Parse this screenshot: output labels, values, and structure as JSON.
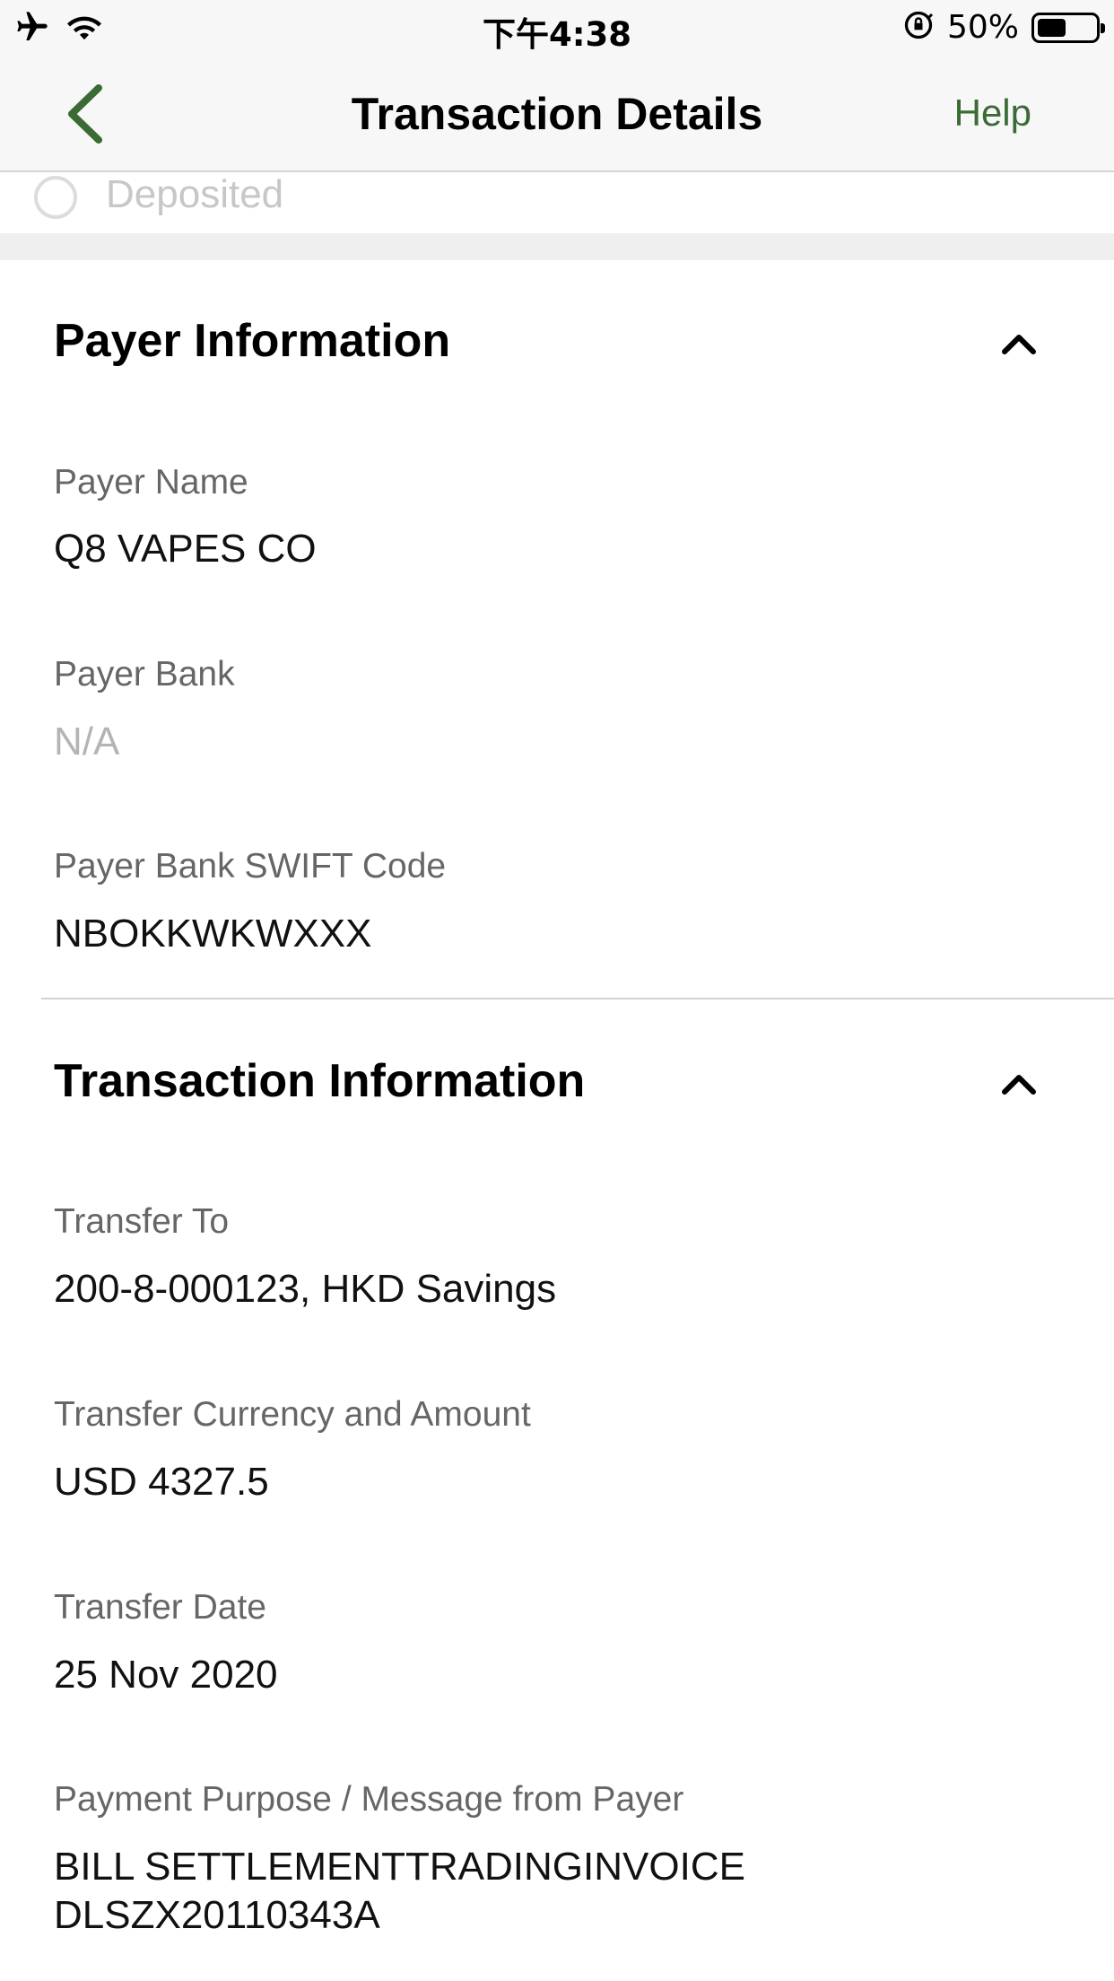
{
  "status_bar": {
    "time": "下午4:38",
    "battery_percent": "50%",
    "battery_level": 0.5,
    "icons": [
      "airplane-icon",
      "wifi-icon",
      "orientation-lock-icon",
      "battery-icon"
    ]
  },
  "nav": {
    "title": "Transaction Details",
    "help_label": "Help",
    "accent_color": "#3b6b35"
  },
  "status_step": {
    "label": "Deposited"
  },
  "payer_section": {
    "title": "Payer Information",
    "fields": [
      {
        "label": "Payer Name",
        "value": "Q8 VAPES CO"
      },
      {
        "label": "Payer Bank",
        "value": "N/A"
      },
      {
        "label": "Payer Bank SWIFT Code",
        "value": "NBOKKWKWXXX"
      }
    ]
  },
  "transaction_section": {
    "title": "Transaction Information",
    "fields": [
      {
        "label": "Transfer To",
        "value": "200-8-000123, HKD Savings"
      },
      {
        "label": "Transfer Currency and Amount",
        "value": "USD 4327.5"
      },
      {
        "label": "Transfer Date",
        "value": "25 Nov 2020"
      },
      {
        "label": "Payment Purpose / Message from Payer",
        "value_line1": "BILL SETTLEMENTTRADINGINVOICE",
        "value_line2": "DLSZX20110343A"
      }
    ]
  }
}
